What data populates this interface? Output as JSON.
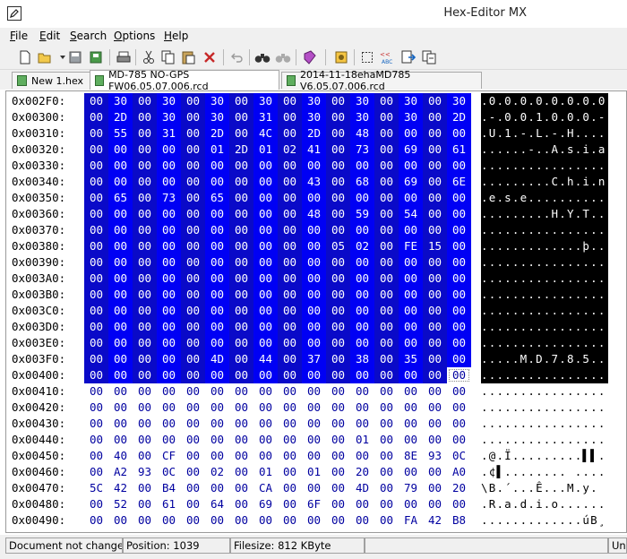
{
  "window": {
    "title": "Hex-Editor MX"
  },
  "menu": [
    {
      "label": "File",
      "u": "F",
      "rest": "ile"
    },
    {
      "label": "Edit",
      "u": "E",
      "rest": "dit"
    },
    {
      "label": "Search",
      "u": "S",
      "rest": "earch"
    },
    {
      "label": "Options",
      "u": "O",
      "rest": "ptions"
    },
    {
      "label": "Help",
      "u": "H",
      "rest": "elp"
    }
  ],
  "toolbar": [
    "new-file-icon",
    "open-file-icon",
    "save-icon",
    "save-as-icon",
    "print-icon",
    "cut-icon",
    "copy-icon",
    "paste-icon",
    "delete-icon",
    "undo-icon",
    "find-icon",
    "find-next-icon",
    "bookmark-icon",
    "settings-icon",
    "select-all-icon",
    "convert-icon",
    "export-icon",
    "compare-icon"
  ],
  "tabs": [
    {
      "label": "New 1.hex",
      "active": false
    },
    {
      "label": "MD-785 NO-GPS FW06.05.07.006.rcd",
      "active": true
    },
    {
      "label": "2014-11-18ehaMD785 V6.05.07.006.rcd",
      "active": false
    }
  ],
  "hex_rows": [
    {
      "addr": "0x002F0:",
      "bytes": [
        "00",
        "30",
        "00",
        "30",
        "00",
        "30",
        "00",
        "30",
        "00",
        "30",
        "00",
        "30",
        "00",
        "30",
        "00",
        "30"
      ],
      "ascii": ".0.0.0.0.0.0.0.0",
      "sel_from": 0,
      "sel_to": 15
    },
    {
      "addr": "0x00300:",
      "bytes": [
        "00",
        "2D",
        "00",
        "30",
        "00",
        "30",
        "00",
        "31",
        "00",
        "30",
        "00",
        "30",
        "00",
        "30",
        "00",
        "2D"
      ],
      "ascii": ".-.0.0.1.0.0.0.-",
      "sel_from": 0,
      "sel_to": 15
    },
    {
      "addr": "0x00310:",
      "bytes": [
        "00",
        "55",
        "00",
        "31",
        "00",
        "2D",
        "00",
        "4C",
        "00",
        "2D",
        "00",
        "48",
        "00",
        "00",
        "00",
        "00"
      ],
      "ascii": ".U.1.-.L.-.H....",
      "sel_from": 0,
      "sel_to": 15
    },
    {
      "addr": "0x00320:",
      "bytes": [
        "00",
        "00",
        "00",
        "00",
        "00",
        "01",
        "2D",
        "01",
        "02",
        "41",
        "00",
        "73",
        "00",
        "69",
        "00",
        "61"
      ],
      "ascii": "......-..A.s.i.a",
      "sel_from": 0,
      "sel_to": 15
    },
    {
      "addr": "0x00330:",
      "bytes": [
        "00",
        "00",
        "00",
        "00",
        "00",
        "00",
        "00",
        "00",
        "00",
        "00",
        "00",
        "00",
        "00",
        "00",
        "00",
        "00"
      ],
      "ascii": "................",
      "sel_from": 0,
      "sel_to": 15
    },
    {
      "addr": "0x00340:",
      "bytes": [
        "00",
        "00",
        "00",
        "00",
        "00",
        "00",
        "00",
        "00",
        "00",
        "43",
        "00",
        "68",
        "00",
        "69",
        "00",
        "6E"
      ],
      "ascii": ".........C.h.i.n",
      "sel_from": 0,
      "sel_to": 15
    },
    {
      "addr": "0x00350:",
      "bytes": [
        "00",
        "65",
        "00",
        "73",
        "00",
        "65",
        "00",
        "00",
        "00",
        "00",
        "00",
        "00",
        "00",
        "00",
        "00",
        "00"
      ],
      "ascii": ".e.s.e..........",
      "sel_from": 0,
      "sel_to": 15
    },
    {
      "addr": "0x00360:",
      "bytes": [
        "00",
        "00",
        "00",
        "00",
        "00",
        "00",
        "00",
        "00",
        "00",
        "48",
        "00",
        "59",
        "00",
        "54",
        "00",
        "00"
      ],
      "ascii": ".........H.Y.T..",
      "sel_from": 0,
      "sel_to": 15
    },
    {
      "addr": "0x00370:",
      "bytes": [
        "00",
        "00",
        "00",
        "00",
        "00",
        "00",
        "00",
        "00",
        "00",
        "00",
        "00",
        "00",
        "00",
        "00",
        "00",
        "00"
      ],
      "ascii": "................",
      "sel_from": 0,
      "sel_to": 15
    },
    {
      "addr": "0x00380:",
      "bytes": [
        "00",
        "00",
        "00",
        "00",
        "00",
        "00",
        "00",
        "00",
        "00",
        "00",
        "05",
        "02",
        "00",
        "FE",
        "15",
        "00"
      ],
      "ascii": ".............þ..",
      "sel_from": 0,
      "sel_to": 15
    },
    {
      "addr": "0x00390:",
      "bytes": [
        "00",
        "00",
        "00",
        "00",
        "00",
        "00",
        "00",
        "00",
        "00",
        "00",
        "00",
        "00",
        "00",
        "00",
        "00",
        "00"
      ],
      "ascii": "................",
      "sel_from": 0,
      "sel_to": 15
    },
    {
      "addr": "0x003A0:",
      "bytes": [
        "00",
        "00",
        "00",
        "00",
        "00",
        "00",
        "00",
        "00",
        "00",
        "00",
        "00",
        "00",
        "00",
        "00",
        "00",
        "00"
      ],
      "ascii": "................",
      "sel_from": 0,
      "sel_to": 15
    },
    {
      "addr": "0x003B0:",
      "bytes": [
        "00",
        "00",
        "00",
        "00",
        "00",
        "00",
        "00",
        "00",
        "00",
        "00",
        "00",
        "00",
        "00",
        "00",
        "00",
        "00"
      ],
      "ascii": "................",
      "sel_from": 0,
      "sel_to": 15
    },
    {
      "addr": "0x003C0:",
      "bytes": [
        "00",
        "00",
        "00",
        "00",
        "00",
        "00",
        "00",
        "00",
        "00",
        "00",
        "00",
        "00",
        "00",
        "00",
        "00",
        "00"
      ],
      "ascii": "................",
      "sel_from": 0,
      "sel_to": 15
    },
    {
      "addr": "0x003D0:",
      "bytes": [
        "00",
        "00",
        "00",
        "00",
        "00",
        "00",
        "00",
        "00",
        "00",
        "00",
        "00",
        "00",
        "00",
        "00",
        "00",
        "00"
      ],
      "ascii": "................",
      "sel_from": 0,
      "sel_to": 15
    },
    {
      "addr": "0x003E0:",
      "bytes": [
        "00",
        "00",
        "00",
        "00",
        "00",
        "00",
        "00",
        "00",
        "00",
        "00",
        "00",
        "00",
        "00",
        "00",
        "00",
        "00"
      ],
      "ascii": "................",
      "sel_from": 0,
      "sel_to": 15
    },
    {
      "addr": "0x003F0:",
      "bytes": [
        "00",
        "00",
        "00",
        "00",
        "00",
        "4D",
        "00",
        "44",
        "00",
        "37",
        "00",
        "38",
        "00",
        "35",
        "00",
        "00"
      ],
      "ascii": ".....M.D.7.8.5..",
      "sel_from": 0,
      "sel_to": 15
    },
    {
      "addr": "0x00400:",
      "bytes": [
        "00",
        "00",
        "00",
        "00",
        "00",
        "00",
        "00",
        "00",
        "00",
        "00",
        "00",
        "00",
        "00",
        "00",
        "00",
        "00"
      ],
      "ascii": "................",
      "sel_from": 0,
      "sel_to": 14,
      "cursor": 15
    },
    {
      "addr": "0x00410:",
      "bytes": [
        "00",
        "00",
        "00",
        "00",
        "00",
        "00",
        "00",
        "00",
        "00",
        "00",
        "00",
        "00",
        "00",
        "00",
        "00",
        "00"
      ],
      "ascii": "................"
    },
    {
      "addr": "0x00420:",
      "bytes": [
        "00",
        "00",
        "00",
        "00",
        "00",
        "00",
        "00",
        "00",
        "00",
        "00",
        "00",
        "00",
        "00",
        "00",
        "00",
        "00"
      ],
      "ascii": "................"
    },
    {
      "addr": "0x00430:",
      "bytes": [
        "00",
        "00",
        "00",
        "00",
        "00",
        "00",
        "00",
        "00",
        "00",
        "00",
        "00",
        "00",
        "00",
        "00",
        "00",
        "00"
      ],
      "ascii": "................"
    },
    {
      "addr": "0x00440:",
      "bytes": [
        "00",
        "00",
        "00",
        "00",
        "00",
        "00",
        "00",
        "00",
        "00",
        "00",
        "00",
        "01",
        "00",
        "00",
        "00",
        "00"
      ],
      "ascii": "................"
    },
    {
      "addr": "0x00450:",
      "bytes": [
        "00",
        "40",
        "00",
        "CF",
        "00",
        "00",
        "00",
        "00",
        "00",
        "00",
        "00",
        "00",
        "00",
        "8E",
        "93",
        "0C"
      ],
      "ascii": ".@.Ï.........▌▌."
    },
    {
      "addr": "0x00460:",
      "bytes": [
        "00",
        "A2",
        "93",
        "0C",
        "00",
        "02",
        "00",
        "01",
        "00",
        "01",
        "00",
        "20",
        "00",
        "00",
        "00",
        "A0"
      ],
      "ascii": ".¢▌........ ...."
    },
    {
      "addr": "0x00470:",
      "bytes": [
        "5C",
        "42",
        "00",
        "B4",
        "00",
        "00",
        "00",
        "CA",
        "00",
        "00",
        "00",
        "4D",
        "00",
        "79",
        "00",
        "20"
      ],
      "ascii": "\\B.´...Ê...M.y. "
    },
    {
      "addr": "0x00480:",
      "bytes": [
        "00",
        "52",
        "00",
        "61",
        "00",
        "64",
        "00",
        "69",
        "00",
        "6F",
        "00",
        "00",
        "00",
        "00",
        "00",
        "00"
      ],
      "ascii": ".R.a.d.i.o......"
    },
    {
      "addr": "0x00490:",
      "bytes": [
        "00",
        "00",
        "00",
        "00",
        "00",
        "00",
        "00",
        "00",
        "00",
        "00",
        "00",
        "00",
        "00",
        "FA",
        "42",
        "B8"
      ],
      "ascii": ".............úB¸"
    }
  ],
  "status": {
    "state": "Document not changed",
    "position": "Position: 1039",
    "filesize": "Filesize: 812 KByte",
    "encoding": "Uni"
  }
}
